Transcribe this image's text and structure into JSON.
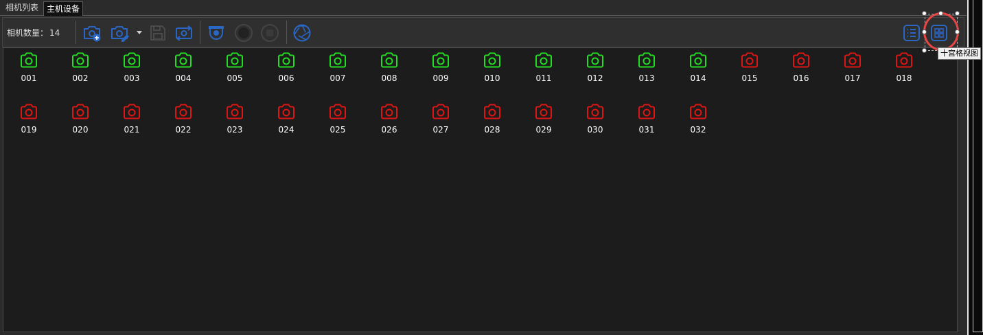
{
  "tabs": [
    {
      "label": "相机列表"
    },
    {
      "label": "主机设备"
    }
  ],
  "toolbar": {
    "count_label": "相机数量：",
    "count_value": "14"
  },
  "tooltip": "十宫格视图",
  "colors": {
    "online": "#22dd22",
    "offline": "#dd1515",
    "icon_blue": "#2a66c4",
    "icon_disabled": "#4a4a4a"
  },
  "cameras": [
    {
      "label": "001",
      "status": "online"
    },
    {
      "label": "002",
      "status": "online"
    },
    {
      "label": "003",
      "status": "online"
    },
    {
      "label": "004",
      "status": "online"
    },
    {
      "label": "005",
      "status": "online"
    },
    {
      "label": "006",
      "status": "online"
    },
    {
      "label": "007",
      "status": "online"
    },
    {
      "label": "008",
      "status": "online"
    },
    {
      "label": "009",
      "status": "online"
    },
    {
      "label": "010",
      "status": "online"
    },
    {
      "label": "011",
      "status": "online"
    },
    {
      "label": "012",
      "status": "online"
    },
    {
      "label": "013",
      "status": "online"
    },
    {
      "label": "014",
      "status": "online"
    },
    {
      "label": "015",
      "status": "offline"
    },
    {
      "label": "016",
      "status": "offline"
    },
    {
      "label": "017",
      "status": "offline"
    },
    {
      "label": "018",
      "status": "offline"
    },
    {
      "label": "019",
      "status": "offline"
    },
    {
      "label": "020",
      "status": "offline"
    },
    {
      "label": "021",
      "status": "offline"
    },
    {
      "label": "022",
      "status": "offline"
    },
    {
      "label": "023",
      "status": "offline"
    },
    {
      "label": "024",
      "status": "offline"
    },
    {
      "label": "025",
      "status": "offline"
    },
    {
      "label": "026",
      "status": "offline"
    },
    {
      "label": "027",
      "status": "offline"
    },
    {
      "label": "028",
      "status": "offline"
    },
    {
      "label": "029",
      "status": "offline"
    },
    {
      "label": "030",
      "status": "offline"
    },
    {
      "label": "031",
      "status": "offline"
    },
    {
      "label": "032",
      "status": "offline"
    }
  ]
}
